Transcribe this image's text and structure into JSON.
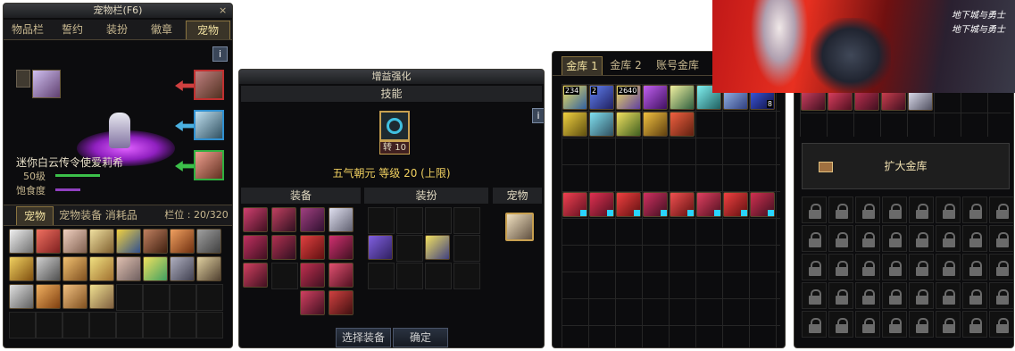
{
  "pet_window": {
    "title": "宠物栏(F6)",
    "tabs": [
      "物品栏",
      "誓约",
      "装扮",
      "徽章",
      "宠物"
    ],
    "pet_name": "迷你白云传令使爱莉希",
    "level": "50级",
    "satiety_label": "饱食度",
    "subtabs": {
      "pet": "宠物",
      "equip_consumable": "宠物装备 消耗品",
      "slots": "栏位 : 20/320"
    },
    "info_icon": "i"
  },
  "buff_window": {
    "title": "增益强化",
    "skill_label": "技能",
    "skill_badge": "转 10",
    "skill_name": "五气朝元 等级 20 (上限)",
    "equip_header": "装备",
    "costume_header": "装扮",
    "pet_header": "宠物",
    "select_equip_button": "选择装备",
    "confirm_button": "确定",
    "info_icon": "i"
  },
  "bank_window": {
    "tabs": [
      "金库 1",
      "金库 2",
      "账号金库"
    ],
    "slot_badges": [
      "234",
      "2",
      "2640",
      "8"
    ]
  },
  "bank_expand_window": {
    "expand_button": "扩大金库"
  },
  "banner": {
    "logo_text_1": "地下城与勇士",
    "logo_text_2": "地下城与勇士"
  },
  "colors": {
    "accent_gold": "#c8a050",
    "green_arrow": "#3cc04a",
    "red_arrow": "#d04040",
    "blue_arrow": "#4ab0e0",
    "magic_circle": "#b040e0"
  }
}
